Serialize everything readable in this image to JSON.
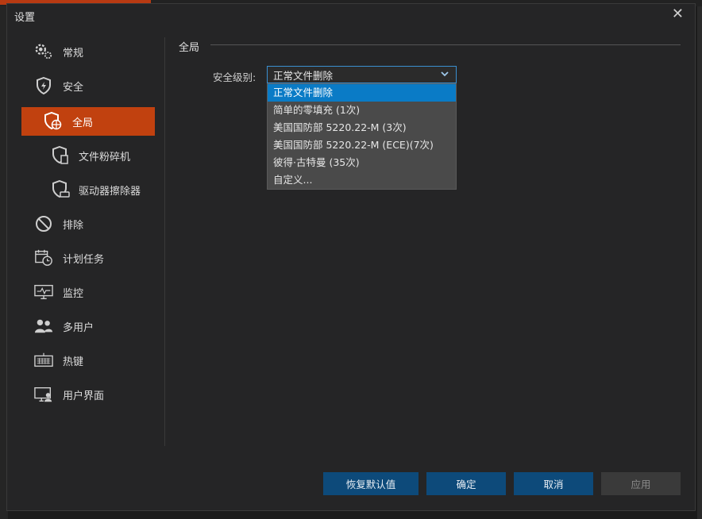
{
  "dialog": {
    "title": "设置"
  },
  "nav": [
    {
      "label": "常规",
      "icon": "gear-icon"
    },
    {
      "label": "安全",
      "icon": "shield-icon"
    },
    {
      "label": "全局",
      "icon": "shield-globe-icon",
      "active": true
    },
    {
      "label": "文件粉碎机",
      "icon": "shield-file-icon"
    },
    {
      "label": "驱动器擦除器",
      "icon": "shield-drive-icon"
    },
    {
      "label": "排除",
      "icon": "prohibited-icon"
    },
    {
      "label": "计划任务",
      "icon": "calendar-clock-icon"
    },
    {
      "label": "监控",
      "icon": "monitor-icon"
    },
    {
      "label": "多用户",
      "icon": "users-icon"
    },
    {
      "label": "热键",
      "icon": "keyboard-icon"
    },
    {
      "label": "用户界面",
      "icon": "user-screen-icon"
    }
  ],
  "main": {
    "section_title": "全局",
    "security_level_label": "安全级别:",
    "security_level_value": "正常文件删除",
    "options": [
      "正常文件删除",
      "简单的零填充 (1次)",
      "美国国防部 5220.22-M (3次)",
      "美国国防部 5220.22-M (ECE)(7次)",
      "彼得·古特曼 (35次)",
      "自定义..."
    ]
  },
  "buttons": {
    "restore": "恢复默认值",
    "ok": "确定",
    "cancel": "取消",
    "apply": "应用"
  },
  "colors": {
    "accent": "#c1410f",
    "selection": "#0a7bc6",
    "button": "#0d4a7a"
  }
}
